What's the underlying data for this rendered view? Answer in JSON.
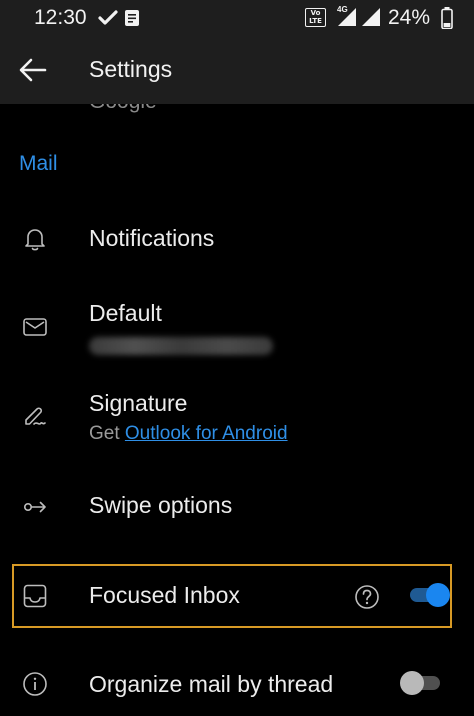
{
  "status_bar": {
    "time": "12:30",
    "volte_label": "VoLTE 2",
    "network_label": "4G",
    "battery_percent": "24%"
  },
  "app_bar": {
    "title": "Settings"
  },
  "account": {
    "partial_label": "Google"
  },
  "section": {
    "header": "Mail"
  },
  "rows": {
    "notifications": {
      "title": "Notifications"
    },
    "default": {
      "title": "Default",
      "subtitle_redacted": true
    },
    "signature": {
      "title": "Signature",
      "subtitle_prefix": "Get",
      "subtitle_link": "Outlook for Android"
    },
    "swipe": {
      "title": "Swipe options"
    },
    "focused": {
      "title": "Focused Inbox",
      "toggle_on": true
    },
    "thread": {
      "title": "Organize mail by thread",
      "toggle_on": false
    }
  },
  "colors": {
    "accent": "#2f8fe6",
    "toggle_on": "#1a86f0",
    "highlight_border": "#d79a25",
    "background": "#000000",
    "bar_background": "#1e1e1e"
  }
}
